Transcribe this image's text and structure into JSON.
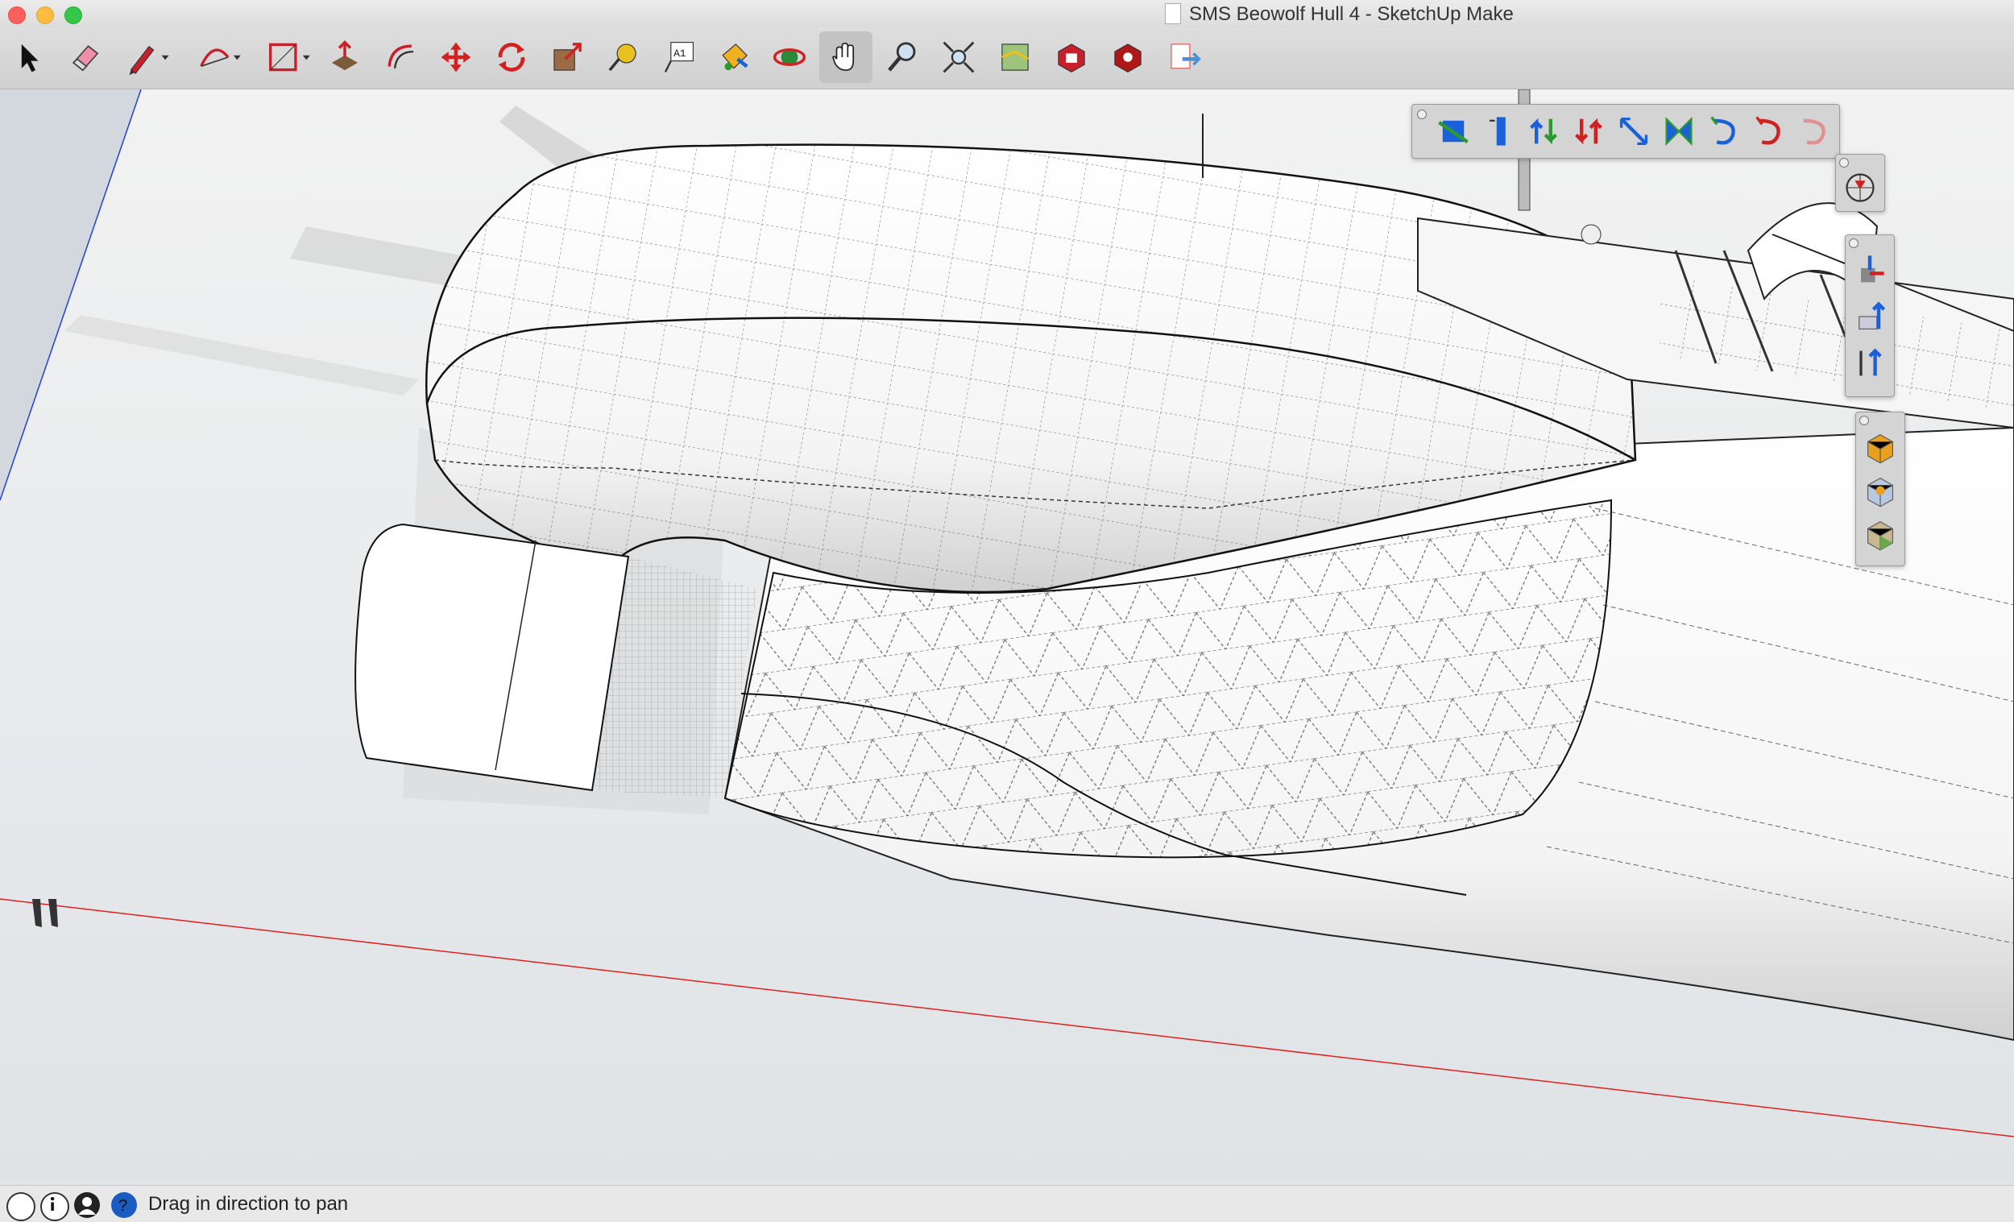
{
  "window": {
    "title": "SMS Beowolf Hull 4 - SketchUp Make"
  },
  "toolbar": {
    "tools": [
      {
        "name": "select-icon"
      },
      {
        "name": "eraser-icon"
      },
      {
        "name": "pencil-line-icon"
      },
      {
        "name": "arc-icon"
      },
      {
        "name": "rectangle-icon"
      },
      {
        "name": "push-pull-icon"
      },
      {
        "name": "offset-icon"
      },
      {
        "name": "move-icon"
      },
      {
        "name": "rotate-icon"
      },
      {
        "name": "scale-icon"
      },
      {
        "name": "tape-measure-icon"
      },
      {
        "name": "text-icon"
      },
      {
        "name": "paint-bucket-icon"
      },
      {
        "name": "orbit-icon"
      },
      {
        "name": "pan-icon"
      },
      {
        "name": "zoom-icon"
      },
      {
        "name": "zoom-extents-icon"
      },
      {
        "name": "geo-location-icon"
      },
      {
        "name": "3d-warehouse-icon"
      },
      {
        "name": "extension-warehouse-icon"
      },
      {
        "name": "send-to-layout-icon"
      }
    ],
    "text_tool_label": "A1",
    "active_tool": "pan-icon"
  },
  "colors": {
    "red_axis": "#e02020",
    "blue_axis": "#2040e0",
    "accent_blue": "#1a60d8",
    "accent_red": "#d02020"
  },
  "status": {
    "text": "Drag in direction to pan"
  }
}
